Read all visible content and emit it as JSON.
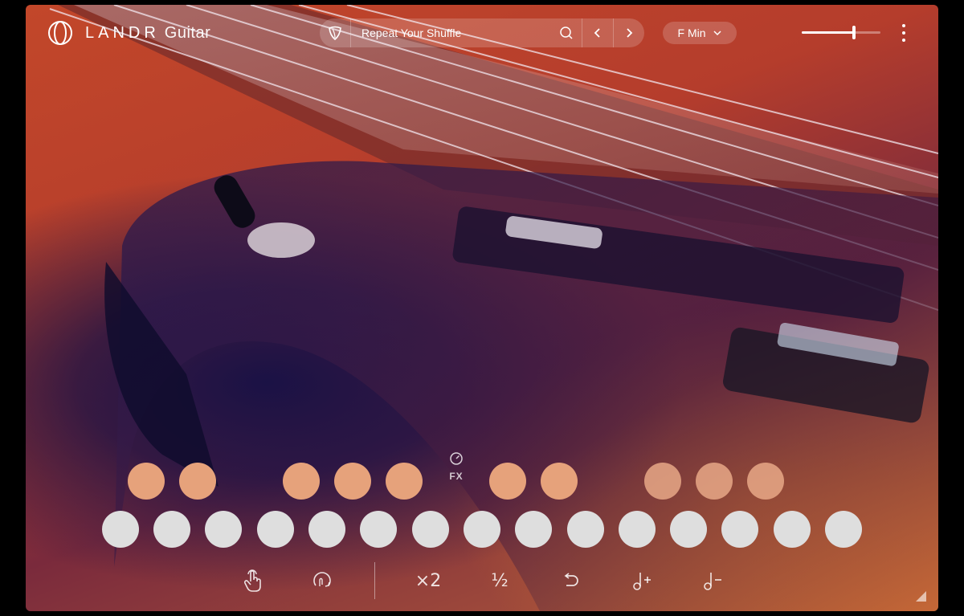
{
  "app": {
    "brand": "LANDR",
    "product": "Guitar"
  },
  "preset": {
    "name": "Repeat Your Shuffle"
  },
  "key": {
    "value": "F Min"
  },
  "volume": {
    "level": 0.66
  },
  "fx": {
    "label": "FX"
  },
  "pads": {
    "chord_count": 10,
    "note_count": 15
  },
  "toolbar": {
    "double_label": "×2",
    "half_label": "½",
    "reverse_label": "⟲"
  },
  "icons": {
    "logo": "landr-rings-logo",
    "shield": "shield-icon",
    "search": "search-icon",
    "prev": "chevron-left-icon",
    "next": "chevron-right-icon",
    "dropdown": "chevron-down-icon",
    "menu": "kebab-menu-icon",
    "tap": "hand-tap-icon",
    "rotate": "rotate-icon",
    "undo": "undo-icon",
    "note_plus": "note-plus-icon",
    "note_minus": "note-minus-icon",
    "resize": "resize-grip-icon"
  },
  "colors": {
    "chord_pad": "#e6a27b",
    "note_pad": "#dedede",
    "background": "#c2472a"
  }
}
